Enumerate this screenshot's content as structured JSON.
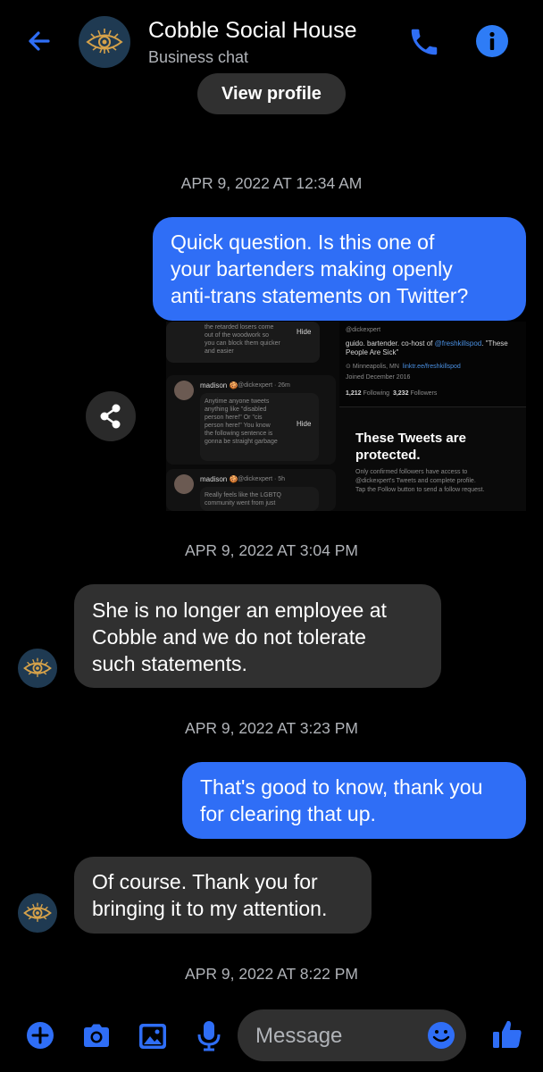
{
  "header": {
    "title": "Cobble Social House",
    "subtitle": "Business chat",
    "view_profile_label": "View profile"
  },
  "messages": [
    {
      "type": "timestamp",
      "text": "APR 9, 2022 AT 12:34 AM"
    },
    {
      "type": "outgoing",
      "lines": [
        "Quick question. Is this one of",
        "your bartenders making openly",
        "anti-trans statements on Twitter?"
      ]
    },
    {
      "type": "timestamp",
      "text": "APR 9, 2022 AT 3:04 PM"
    },
    {
      "type": "incoming",
      "lines": [
        "She is no longer an employee at",
        "Cobble and we do not tolerate",
        "such statements."
      ]
    },
    {
      "type": "timestamp",
      "text": "APR 9, 2022 AT 3:23 PM"
    },
    {
      "type": "outgoing",
      "lines": [
        "That's good to know, thank you",
        "for clearing that up."
      ]
    },
    {
      "type": "incoming",
      "lines": [
        "Of course. Thank you for",
        "bringing it to my attention."
      ]
    },
    {
      "type": "timestamp",
      "text": "APR 9, 2022 AT 8:22 PM"
    }
  ],
  "shared_image": {
    "tweets": [
      {
        "lines": [
          "the retarded losers come",
          "out of the woodwork so",
          "you can block them quicker",
          "and easier"
        ],
        "hide": "Hide"
      },
      {
        "name": "madison 🍪",
        "handle": "@dickexpert · 26m",
        "lines": [
          "Anytime anyone tweets",
          "anything like \"disabled",
          "person here!\" Or \"cis",
          "person here!\" You know",
          "the following sentence is",
          "gonna be straight garbage"
        ],
        "hide": "Hide"
      },
      {
        "name": "madison 🍪",
        "handle": "@dickexpert · 5h",
        "lines": [
          "Really feels like the LGBTQ",
          "community went from just"
        ]
      }
    ],
    "profile": {
      "handle": "@dickexpert",
      "bio_prefix": "guido. bartender. co-host of ",
      "bio_link": "@freshkillspod",
      "bio_suffix": ". \"These",
      "bio_line2": "People Are Sick\"",
      "location": "Minneapolis, MN",
      "link": "linktr.ee/freshkillspod",
      "joined": "Joined December 2016",
      "following_count": "1,212",
      "following_label": "Following",
      "followers_count": "3,232",
      "followers_label": "Followers",
      "protected_title_1": "These Tweets are",
      "protected_title_2": "protected.",
      "protected_text_1": "Only confirmed followers have access to",
      "protected_text_2": "@dickexpert's Tweets and complete profile.",
      "protected_text_3": "Tap the Follow button to send a follow request."
    }
  },
  "composer": {
    "placeholder": "Message"
  },
  "colors": {
    "accent": "#2f6ef6",
    "incoming_bubble": "#303030",
    "background": "#000000"
  },
  "icons": [
    "back-arrow-icon",
    "phone-icon",
    "info-icon",
    "share-icon",
    "plus-icon",
    "camera-icon",
    "image-icon",
    "mic-icon",
    "emoji-icon",
    "thumbs-up-icon"
  ]
}
